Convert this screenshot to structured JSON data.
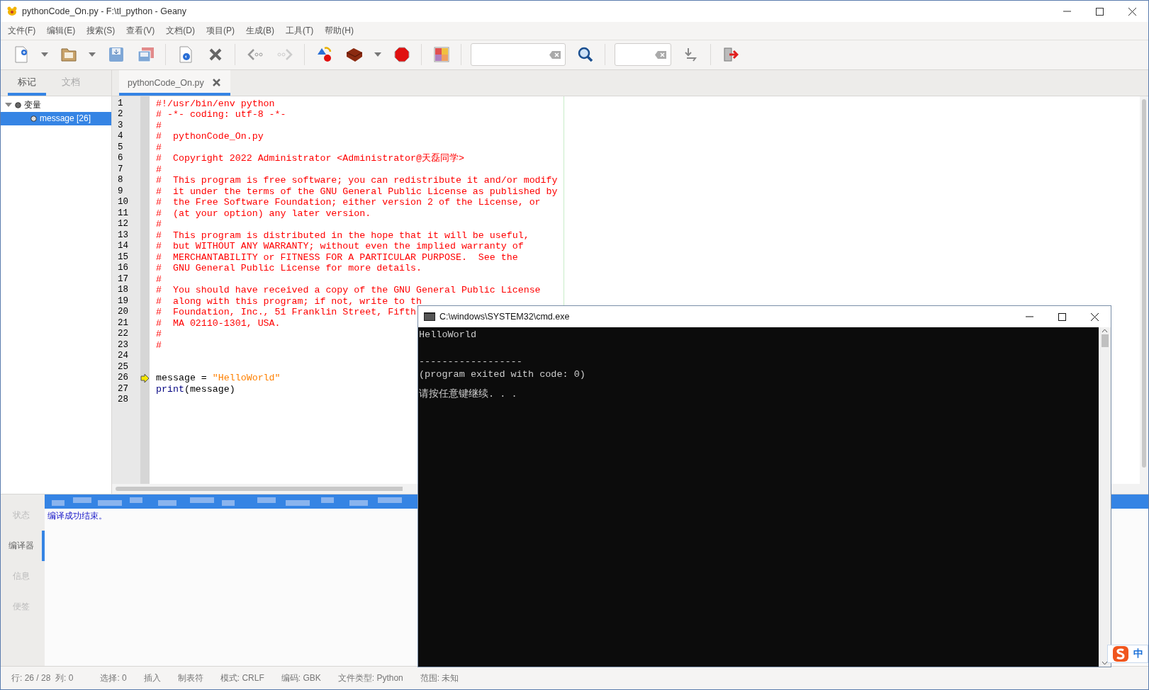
{
  "window": {
    "title": "pythonCode_On.py - F:\\tl_python - Geany"
  },
  "menu": [
    "文件(F)",
    "编辑(E)",
    "搜索(S)",
    "查看(V)",
    "文档(D)",
    "项目(P)",
    "生成(B)",
    "工具(T)",
    "帮助(H)"
  ],
  "sidebar": {
    "tabs": [
      {
        "label": "标记",
        "selected": true
      },
      {
        "label": "文档",
        "selected": false
      }
    ],
    "tree": [
      {
        "label": "变量",
        "expanded": true,
        "selected": false,
        "children": [
          {
            "label": "message [26]",
            "selected": true
          }
        ]
      }
    ]
  },
  "editor": {
    "tabs": [
      {
        "label": "pythonCode_On.py",
        "selected": true
      }
    ],
    "lines": [
      {
        "number": "1",
        "marked": false,
        "segments": [
          {
            "kind": "comment",
            "text": "#!/usr/bin/env python"
          }
        ]
      },
      {
        "number": "2",
        "marked": false,
        "segments": [
          {
            "kind": "comment",
            "text": "# -*- coding: utf-8 -*-"
          }
        ]
      },
      {
        "number": "3",
        "marked": false,
        "segments": [
          {
            "kind": "comment",
            "text": "#"
          }
        ]
      },
      {
        "number": "4",
        "marked": false,
        "segments": [
          {
            "kind": "comment",
            "text": "#  pythonCode_On.py"
          }
        ]
      },
      {
        "number": "5",
        "marked": false,
        "segments": [
          {
            "kind": "comment",
            "text": "#"
          }
        ]
      },
      {
        "number": "6",
        "marked": false,
        "segments": [
          {
            "kind": "comment",
            "text": "#  Copyright 2022 Administrator <Administrator@天磊同学>"
          }
        ]
      },
      {
        "number": "7",
        "marked": false,
        "segments": [
          {
            "kind": "comment",
            "text": "#"
          }
        ]
      },
      {
        "number": "8",
        "marked": false,
        "segments": [
          {
            "kind": "comment",
            "text": "#  This program is free software; you can redistribute it and/or modify"
          }
        ]
      },
      {
        "number": "9",
        "marked": false,
        "segments": [
          {
            "kind": "comment",
            "text": "#  it under the terms of the GNU General Public License as published by"
          }
        ]
      },
      {
        "number": "10",
        "marked": false,
        "segments": [
          {
            "kind": "comment",
            "text": "#  the Free Software Foundation; either version 2 of the License, or"
          }
        ]
      },
      {
        "number": "11",
        "marked": false,
        "segments": [
          {
            "kind": "comment",
            "text": "#  (at your option) any later version."
          }
        ]
      },
      {
        "number": "12",
        "marked": false,
        "segments": [
          {
            "kind": "comment",
            "text": "#"
          }
        ]
      },
      {
        "number": "13",
        "marked": false,
        "segments": [
          {
            "kind": "comment",
            "text": "#  This program is distributed in the hope that it will be useful,"
          }
        ]
      },
      {
        "number": "14",
        "marked": false,
        "segments": [
          {
            "kind": "comment",
            "text": "#  but WITHOUT ANY WARRANTY; without even the implied warranty of"
          }
        ]
      },
      {
        "number": "15",
        "marked": false,
        "segments": [
          {
            "kind": "comment",
            "text": "#  MERCHANTABILITY or FITNESS FOR A PARTICULAR PURPOSE.  See the"
          }
        ]
      },
      {
        "number": "16",
        "marked": false,
        "segments": [
          {
            "kind": "comment",
            "text": "#  GNU General Public License for more details."
          }
        ]
      },
      {
        "number": "17",
        "marked": false,
        "segments": [
          {
            "kind": "comment",
            "text": "#"
          }
        ]
      },
      {
        "number": "18",
        "marked": false,
        "segments": [
          {
            "kind": "comment",
            "text": "#  You should have received a copy of the GNU General Public License"
          }
        ]
      },
      {
        "number": "19",
        "marked": false,
        "segments": [
          {
            "kind": "comment",
            "text": "#  along with this program; if not, write to th"
          }
        ]
      },
      {
        "number": "20",
        "marked": false,
        "segments": [
          {
            "kind": "comment",
            "text": "#  Foundation, Inc., 51 Franklin Street, Fifth"
          }
        ]
      },
      {
        "number": "21",
        "marked": false,
        "segments": [
          {
            "kind": "comment",
            "text": "#  MA 02110-1301, USA."
          }
        ]
      },
      {
        "number": "22",
        "marked": false,
        "segments": [
          {
            "kind": "comment",
            "text": "#"
          }
        ]
      },
      {
        "number": "23",
        "marked": false,
        "segments": [
          {
            "kind": "comment",
            "text": "#"
          }
        ]
      },
      {
        "number": "24",
        "marked": false
      },
      {
        "number": "25",
        "marked": false
      },
      {
        "number": "26",
        "marked": true,
        "segments": [
          {
            "kind": "plain",
            "text": "message = "
          },
          {
            "kind": "string",
            "text": "\"HelloWorld\""
          }
        ]
      },
      {
        "number": "27",
        "marked": false,
        "segments": [
          {
            "kind": "keyword",
            "text": "print"
          },
          {
            "kind": "plain",
            "text": "(message)"
          }
        ]
      },
      {
        "number": "28",
        "marked": false
      }
    ]
  },
  "message_panel": {
    "tabs": [
      {
        "label": "状态",
        "selected": false
      },
      {
        "label": "编译器",
        "selected": true
      },
      {
        "label": "信息",
        "selected": false
      },
      {
        "label": "便签",
        "selected": false
      }
    ],
    "rows": [
      {
        "kind": "redacted",
        "selected": true
      },
      {
        "kind": "text",
        "text": "编译成功结束。",
        "selected": false
      }
    ]
  },
  "status_bar": [
    "行: 26 / 28  列: 0",
    "选择: 0",
    "插入",
    "制表符",
    "模式: CRLF",
    "编码: GBK",
    "文件类型: Python",
    "范围: 未知"
  ],
  "console": {
    "title": "C:\\windows\\SYSTEM32\\cmd.exe",
    "lines": [
      {
        "kind": "output",
        "text": "HelloWorld"
      },
      {
        "kind": "separator",
        "text": "------------------"
      },
      {
        "kind": "status",
        "text": "(program exited with code: 0)"
      },
      {
        "kind": "prompt",
        "text": "请按任意键继续. . ."
      }
    ]
  },
  "ime": {
    "label": "中"
  }
}
